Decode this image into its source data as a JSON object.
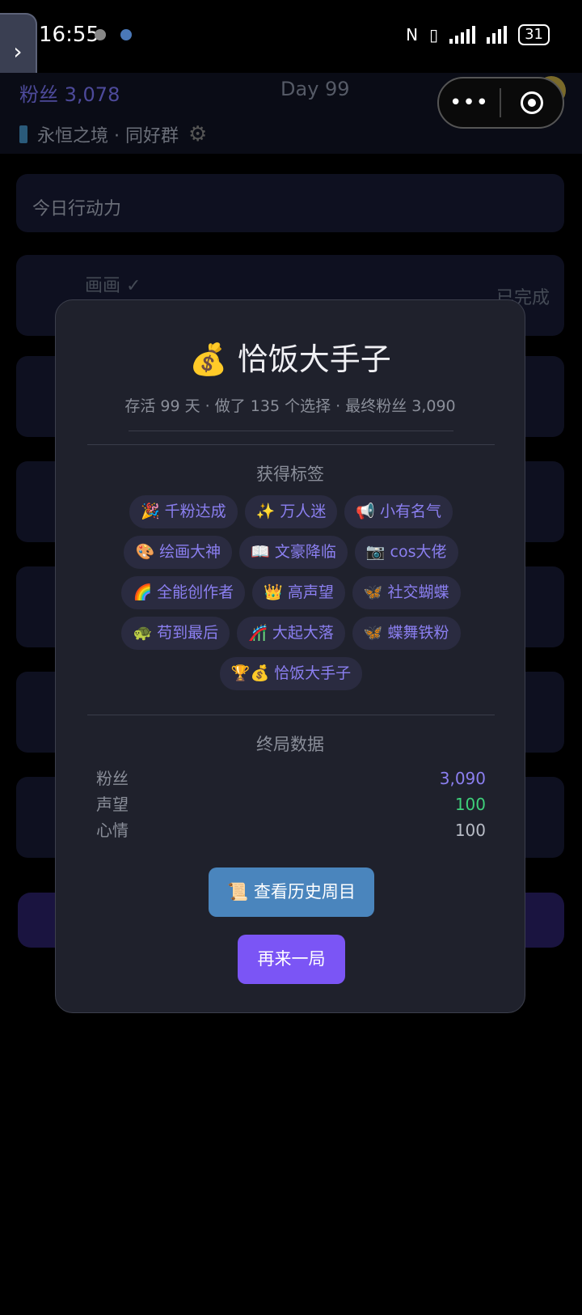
{
  "status_bar": {
    "time": "16:55",
    "battery": "31"
  },
  "background": {
    "fans_label": "粉丝 3,078",
    "day_label": "Day 99",
    "group_name": "永恒之境 · 同好群",
    "action_section": "今日行动力",
    "first_action": "画画 ✓",
    "first_action_status": "已完成"
  },
  "modal": {
    "title": "💰 恰饭大手子",
    "subtitle": "存活 99 天 · 做了 135 个选择 · 最终粉丝 3,090",
    "tags_heading": "获得标签",
    "tags": [
      "🎉 千粉达成",
      "✨ 万人迷",
      "📢 小有名气",
      "🎨 绘画大神",
      "📖 文豪降临",
      "📷 cos大佬",
      "🌈 全能创作者",
      "👑 高声望",
      "🦋 社交蝴蝶",
      "🐢 苟到最后",
      "🎢 大起大落",
      "🦋 蝶舞铁粉",
      "🏆💰 恰饭大手子"
    ],
    "stats_heading": "终局数据",
    "stats": [
      {
        "label": "粉丝",
        "value": "3,090",
        "color": "#8b7ff0"
      },
      {
        "label": "声望",
        "value": "100",
        "color": "#3ed07a"
      },
      {
        "label": "心情",
        "value": "100",
        "color": "#b8bcc6"
      }
    ],
    "history_button": "📜 查看历史周目",
    "replay_button": "再来一局"
  }
}
